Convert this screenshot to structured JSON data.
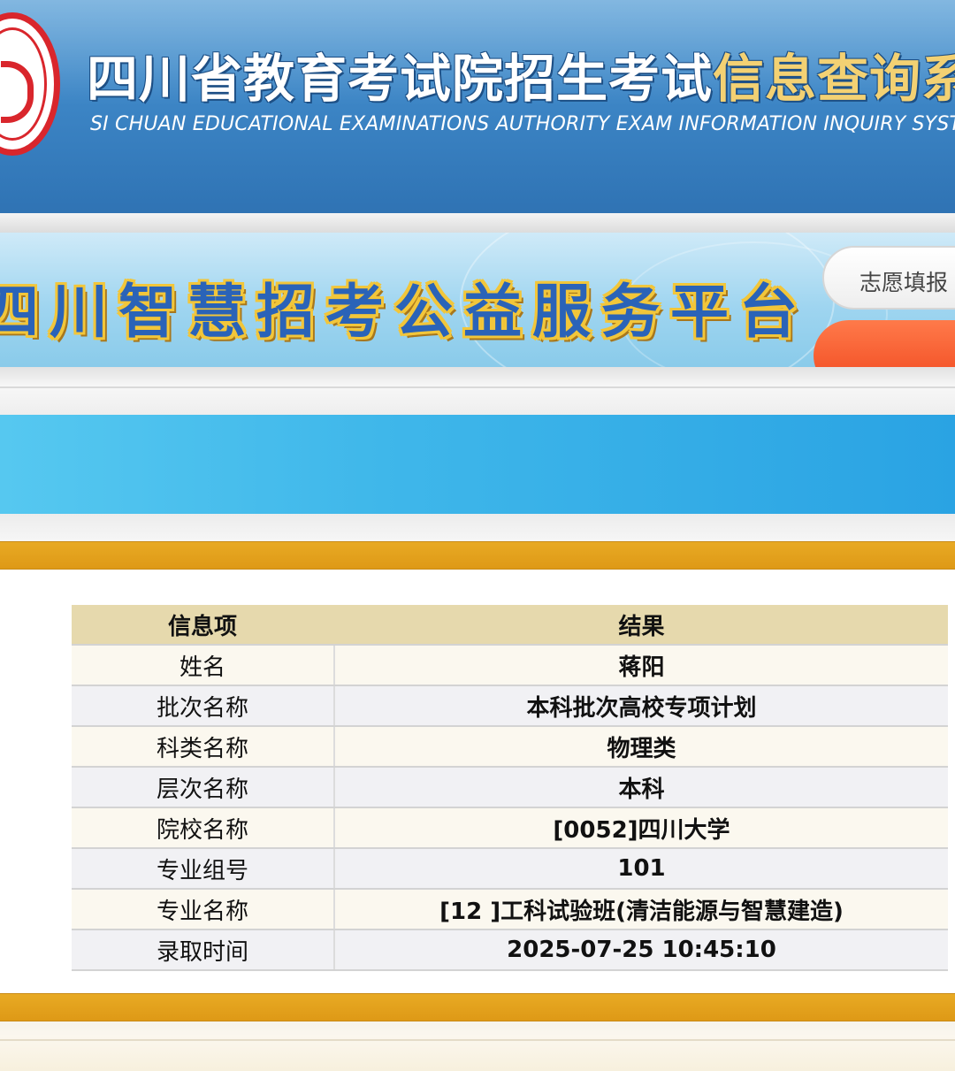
{
  "header": {
    "title_main": "四川省教育考试院招生考试",
    "title_highlight": "信息查询系统",
    "subtitle": "SI CHUAN EDUCATIONAL EXAMINATIONS AUTHORITY EXAM INFORMATION INQUIRY SYSTEM",
    "brand_color": "#3d86c6",
    "highlight_color": "#f3d173",
    "seal_color": "#d9262c"
  },
  "banner": {
    "title": "四川智慧招考公益服务平台",
    "nav_pill_label": "志愿填报",
    "title_color": "#2a63b8",
    "outline_color": "#f2c63a",
    "orange_pill_color": "#f0471e"
  },
  "result_table": {
    "columns": [
      "信息项",
      "结果"
    ],
    "rows": [
      {
        "item": "姓名",
        "value": "蒋阳"
      },
      {
        "item": "批次名称",
        "value": "本科批次高校专项计划"
      },
      {
        "item": "科类名称",
        "value": "物理类"
      },
      {
        "item": "层次名称",
        "value": "本科"
      },
      {
        "item": "院校名称",
        "value": "[0052]四川大学"
      },
      {
        "item": "专业组号",
        "value": "101"
      },
      {
        "item": "专业名称",
        "value": "[12 ]工科试验班(清洁能源与智慧建造)"
      },
      {
        "item": "录取时间",
        "value": "2025-07-25 10:45:10"
      }
    ],
    "header_color": "#e6d9ad",
    "accent_bar_color": "#e0a01a"
  }
}
